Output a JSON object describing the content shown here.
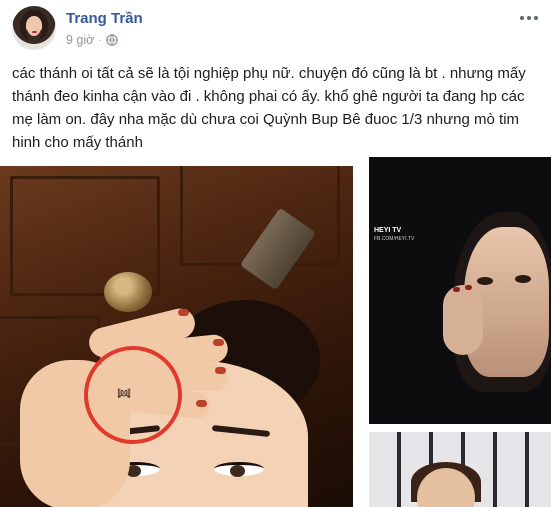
{
  "post": {
    "author": "Trang Trần",
    "time": "9 giờ",
    "separator": "·",
    "privacy_icon": "globe-icon",
    "menu_icon": "more-options-icon",
    "text": "các thánh oi tất cả sẽ là tội nghiệp phụ nữ. chuyện đó cũng là bt . nhưng mấy thánh đeo kinha cận vào đi . không phai có ấy. khổ ghê người ta đang hp các mẹ làm on. đây nha mặc dù chưa coi Quỳnh Bup Bê đuoc 1/3 nhưng mò tim hinh cho mấy thánh"
  },
  "photos": {
    "top_right": {
      "watermark_title": "HEYI TV",
      "watermark_sub": "FB.COM/HEYI.TV"
    }
  },
  "colors": {
    "author_link": "#385898",
    "meta_text": "#90949c",
    "annotation_circle": "#e03a2f"
  }
}
